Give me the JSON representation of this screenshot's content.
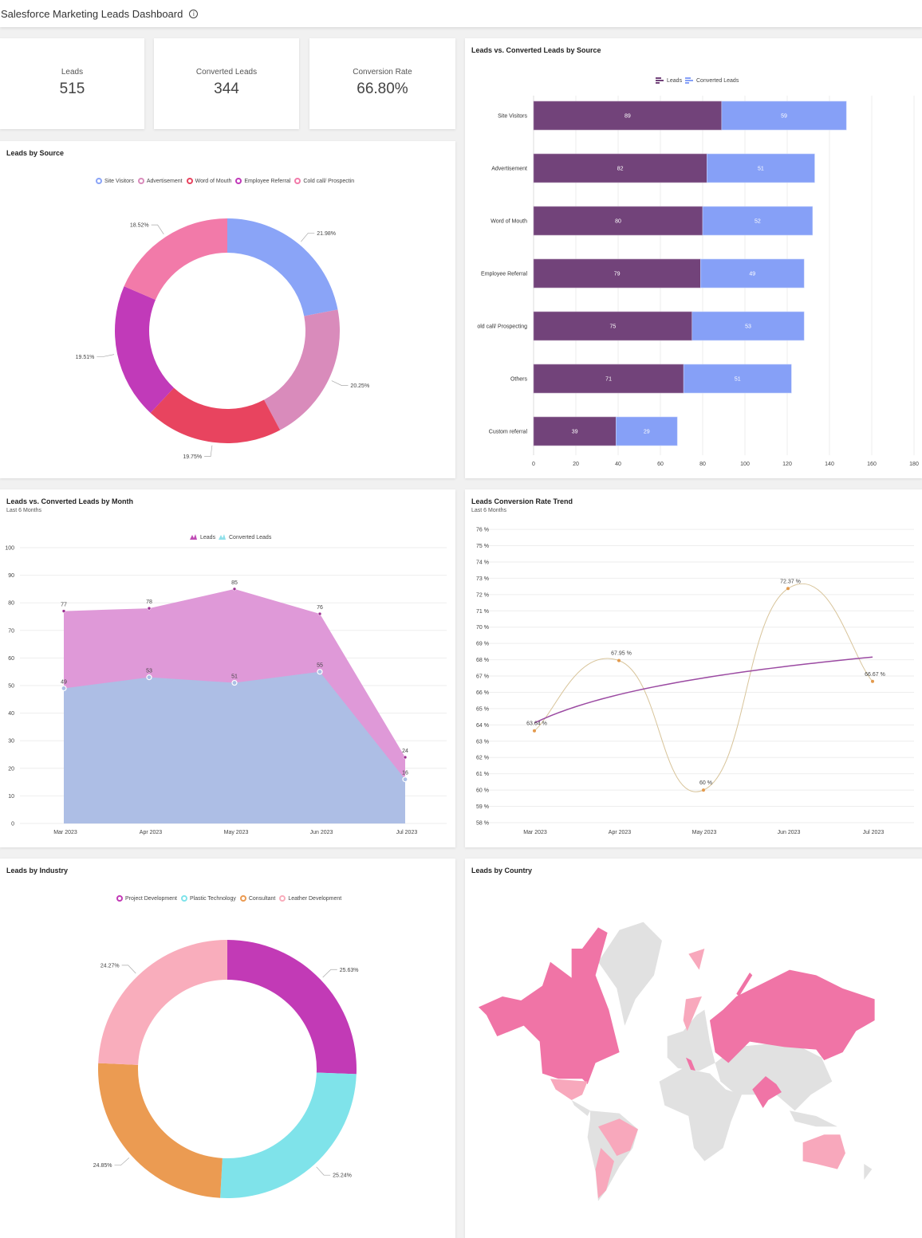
{
  "header": {
    "title": "Salesforce Marketing Leads Dashboard",
    "info_icon": "info-icon"
  },
  "kpis": [
    {
      "label": "Leads",
      "value": "515"
    },
    {
      "label": "Converted Leads",
      "value": "344"
    },
    {
      "label": "Conversion Rate",
      "value": "66.80%"
    }
  ],
  "colors": {
    "leads_bar": "#72437a",
    "converted_bar": "#86a0f7",
    "leads_area": "#df99d8",
    "converted_area": "#abbfe5",
    "trend_spline": "#d8c49a",
    "trend_line": "#9b4aa2",
    "map_high": "#f074a6",
    "map_low": "#f8a8bc",
    "map_none": "#e1e1e1"
  },
  "chart_data": [
    {
      "id": "source",
      "type": "pie",
      "title": "Leads by Source",
      "donut": true,
      "legend": [
        "Site Visitors",
        "Advertisement",
        "Word of Mouth",
        "Employee Referral",
        "Cold call/ Prospectin"
      ],
      "slices": [
        {
          "value": 21.98,
          "label": "21.98%",
          "color": "#8aa4f7"
        },
        {
          "value": 20.25,
          "label": "20.25%",
          "color": "#d98bbb"
        },
        {
          "value": 19.75,
          "label": "19.75%",
          "color": "#e8445f"
        },
        {
          "value": 19.51,
          "label": "19.51%",
          "color": "#c13ab9"
        },
        {
          "value": 18.52,
          "label": "18.52%",
          "color": "#f27aa9"
        }
      ]
    },
    {
      "id": "bysource",
      "type": "bar",
      "orientation": "horizontal",
      "stacked": true,
      "title": "Leads vs. Converted Leads by Source",
      "categories": [
        "Site Visitors",
        "Advertisement",
        "Word of Mouth",
        "Employee Referral",
        "old call/ Prospecting",
        "Others",
        "Custom referral"
      ],
      "series": [
        {
          "name": "Leads",
          "values": [
            89,
            82,
            80,
            79,
            75,
            71,
            39
          ]
        },
        {
          "name": "Converted Leads",
          "values": [
            59,
            51,
            52,
            49,
            53,
            51,
            29
          ]
        }
      ],
      "xlim": [
        0,
        180
      ],
      "xticks": [
        "0",
        "20",
        "40",
        "60",
        "80",
        "100",
        "120",
        "140",
        "160",
        "180"
      ],
      "legend": "top",
      "grid": true
    },
    {
      "id": "bymonth",
      "type": "area",
      "title": "Leads vs. Converted Leads by Month",
      "subtitle": "Last 6 Months",
      "categories": [
        "Mar 2023",
        "Apr 2023",
        "May 2023",
        "Jun 2023",
        "Jul 2023"
      ],
      "series": [
        {
          "name": "Leads",
          "values": [
            77,
            78,
            85,
            76,
            24
          ]
        },
        {
          "name": "Converted Leads",
          "values": [
            49,
            53,
            51,
            55,
            16
          ]
        }
      ],
      "ylim": [
        0,
        100
      ],
      "yticks": [
        "0",
        "10",
        "20",
        "30",
        "40",
        "50",
        "60",
        "70",
        "80",
        "90",
        "100"
      ],
      "legend": "top",
      "grid": true
    },
    {
      "id": "trend",
      "type": "line",
      "title": "Leads Conversion Rate Trend",
      "subtitle": "Last 6 Months",
      "categories": [
        "Mar 2023",
        "Apr 2023",
        "May 2023",
        "Jun 2023",
        "Jul 2023"
      ],
      "values": [
        63.64,
        67.95,
        60,
        72.37,
        66.67
      ],
      "labels": [
        "63.64 %",
        "67.95 %",
        "60 %",
        "72.37 %",
        "66.67 %"
      ],
      "trendline": "logarithmic",
      "ylim": [
        58,
        76
      ],
      "yticks": [
        "58 %",
        "59 %",
        "60 %",
        "61 %",
        "62 %",
        "63 %",
        "64 %",
        "65 %",
        "66 %",
        "67 %",
        "68 %",
        "69 %",
        "70 %",
        "71 %",
        "72 %",
        "73 %",
        "74 %",
        "75 %",
        "76 %"
      ],
      "grid": true
    },
    {
      "id": "industry",
      "type": "pie",
      "title": "Leads by Industry",
      "donut": true,
      "legend": [
        "Project Development",
        "Plastic Technology",
        "Consultant",
        "Leather Development"
      ],
      "slices": [
        {
          "value": 25.63,
          "label": "25.63%",
          "color": "#c23ab6"
        },
        {
          "value": 25.24,
          "label": "25.24%",
          "color": "#7fe3ea"
        },
        {
          "value": 24.85,
          "label": "24.85%",
          "color": "#eb9b52"
        },
        {
          "value": 24.27,
          "label": "24.27%",
          "color": "#f9adbc"
        }
      ]
    }
  ],
  "country": {
    "title": "Leads by Country"
  }
}
